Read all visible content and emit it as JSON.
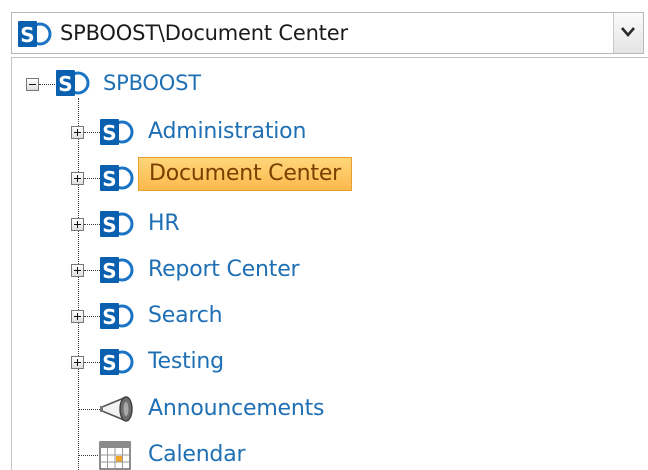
{
  "combo": {
    "value": "SPBOOST\\Document Center",
    "icon": "sharepoint-site-icon"
  },
  "tree": {
    "root": {
      "label": "SPBOOST",
      "icon": "sharepoint-site-icon",
      "state": "expanded"
    },
    "children": [
      {
        "label": "Administration",
        "icon": "sharepoint-site-icon",
        "type": "site",
        "state": "collapsed"
      },
      {
        "label": "Document Center",
        "icon": "sharepoint-site-icon",
        "type": "site",
        "state": "collapsed",
        "selected": true
      },
      {
        "label": "HR",
        "icon": "sharepoint-site-icon",
        "type": "site",
        "state": "collapsed"
      },
      {
        "label": "Report Center",
        "icon": "sharepoint-site-icon",
        "type": "site",
        "state": "collapsed"
      },
      {
        "label": "Search",
        "icon": "sharepoint-site-icon",
        "type": "site",
        "state": "collapsed"
      },
      {
        "label": "Testing",
        "icon": "sharepoint-site-icon",
        "type": "site",
        "state": "collapsed"
      },
      {
        "label": "Announcements",
        "icon": "megaphone-icon",
        "type": "list"
      },
      {
        "label": "Calendar",
        "icon": "calendar-icon",
        "type": "list"
      }
    ]
  },
  "colors": {
    "link": "#1f6fb4",
    "selection_fill": "#fcc25a",
    "selection_border": "#e89f2d",
    "sharepoint_blue": "#0a5fae"
  }
}
